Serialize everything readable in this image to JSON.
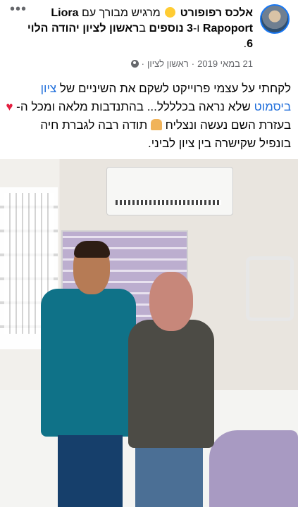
{
  "header": {
    "author": "אלכס רפופורט",
    "feeling_text": "מרגיש מבורך",
    "with_text": "עם",
    "tagged_name": "Liora Rapoport",
    "and_text": "ו-",
    "others_text": "3 נוספים",
    "location_prefix": "ב",
    "location_city": "ראשון לציון",
    "location_address": "יהודה הלוי 6",
    "location_address_suffix": ".",
    "date": "21 במאי 2019",
    "place": "ראשון לציון",
    "separator": "·"
  },
  "post": {
    "line1_prefix": "לקחתי על עצמי פרוייקט לשקם את השיניים של",
    "name_link": "ציון ביסמוט",
    "line1_suffix": "שלא נראה בכלללל... בהתנדבות מלאה ומכל ה-",
    "line2": "בעזרת השם נעשה ונצליח",
    "line3": "תודה רבה לגברת חיה בונפיל שקישרה בין ציון לביני."
  },
  "icons": {
    "more": "more-icon",
    "globe": "globe-icon",
    "heart": "heart-icon",
    "praying": "praying-hands-icon",
    "smile": "smile-emoji-icon"
  },
  "colors": {
    "link": "#216fdb",
    "heart": "#e41e3f",
    "muted": "#65676b",
    "text": "#050505"
  }
}
